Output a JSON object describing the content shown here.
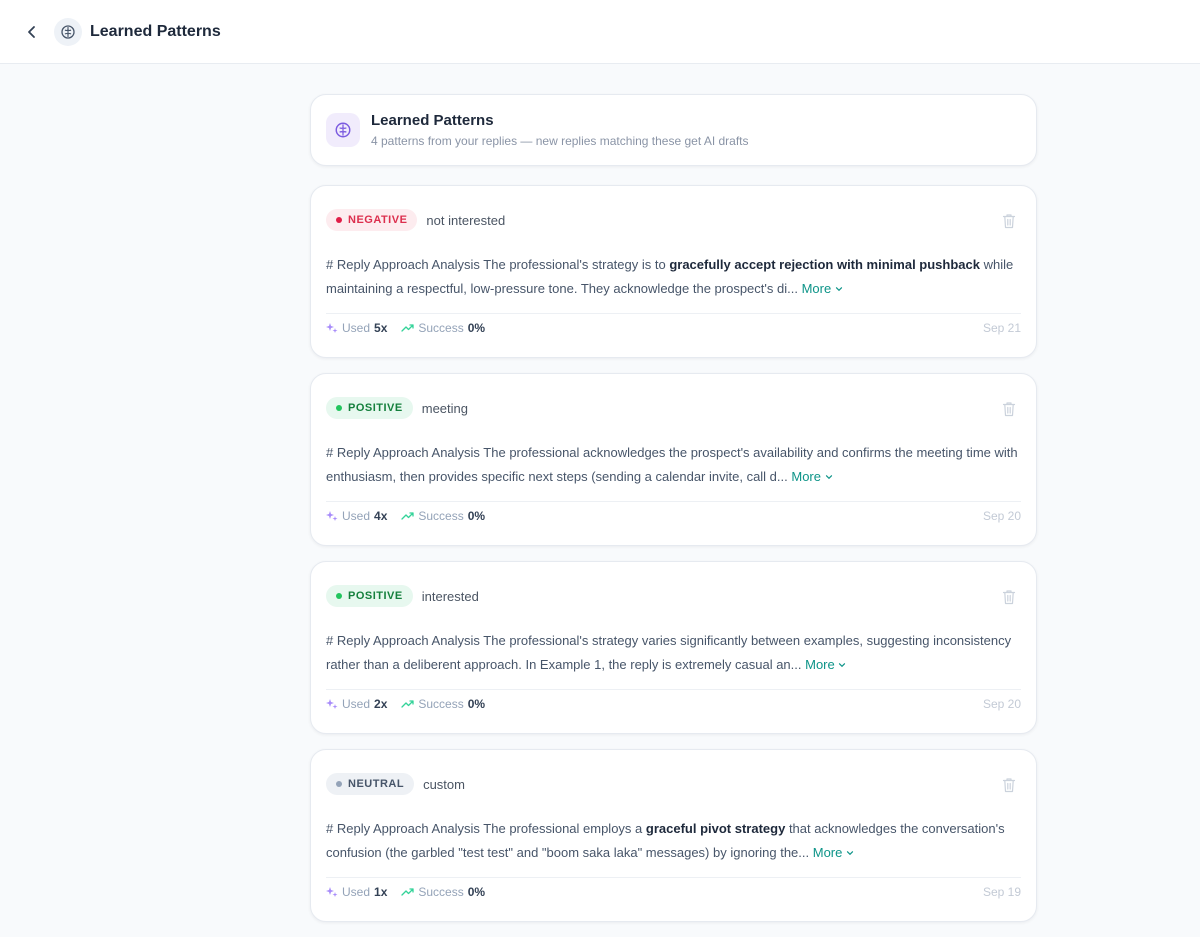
{
  "topbar": {
    "title": "Learned Patterns",
    "back_icon": "chevron-left-icon",
    "icon": "brain-icon"
  },
  "header": {
    "title": "Learned Patterns",
    "subtitle": "4 patterns from your replies — new replies matching these get AI drafts",
    "icon": "brain-icon"
  },
  "patterns": [
    {
      "sentiment": "NEGATIVE",
      "sentiment_class": "negative",
      "category": "not interested",
      "desc_pre": "# Reply Approach Analysis The professional's strategy is to ",
      "desc_bold": "gracefully accept rejection with minimal pushback",
      "desc_post": " while maintaining a respectful, low-pressure tone. They acknowledge the prospect's di... ",
      "more_label": "More",
      "used_label": "Used",
      "used_value": "5x",
      "success_label": "Success",
      "success_value": "0%",
      "date": "Sep 21"
    },
    {
      "sentiment": "POSITIVE",
      "sentiment_class": "positive",
      "category": "meeting",
      "desc_pre": "# Reply Approach Analysis The professional acknowledges the prospect's availability and confirms the meeting time with enthusiasm, then provides specific next steps (sending a calendar invite, call d... ",
      "desc_bold": "",
      "desc_post": "",
      "more_label": "More",
      "used_label": "Used",
      "used_value": "4x",
      "success_label": "Success",
      "success_value": "0%",
      "date": "Sep 20"
    },
    {
      "sentiment": "POSITIVE",
      "sentiment_class": "positive",
      "category": "interested",
      "desc_pre": "# Reply Approach Analysis The professional's strategy varies significantly between examples, suggesting inconsistency rather than a deliberent approach. In Example 1, the reply is extremely casual an... ",
      "desc_bold": "",
      "desc_post": "",
      "more_label": "More",
      "used_label": "Used",
      "used_value": "2x",
      "success_label": "Success",
      "success_value": "0%",
      "date": "Sep 20"
    },
    {
      "sentiment": "NEUTRAL",
      "sentiment_class": "neutral",
      "category": "custom",
      "desc_pre": "# Reply Approach Analysis The professional employs a ",
      "desc_bold": "graceful pivot strategy",
      "desc_post": " that acknowledges the conversation's confusion (the garbled \"test test\" and \"boom saka laka\" messages) by ignoring the... ",
      "more_label": "More",
      "used_label": "Used",
      "used_value": "1x",
      "success_label": "Success",
      "success_value": "0%",
      "date": "Sep 19"
    }
  ],
  "colors": {
    "accent_purple": "#7c5ce0",
    "accent_teal": "#0d9488",
    "negative": "#dc2f4e",
    "positive": "#15803d",
    "neutral": "#475569"
  }
}
